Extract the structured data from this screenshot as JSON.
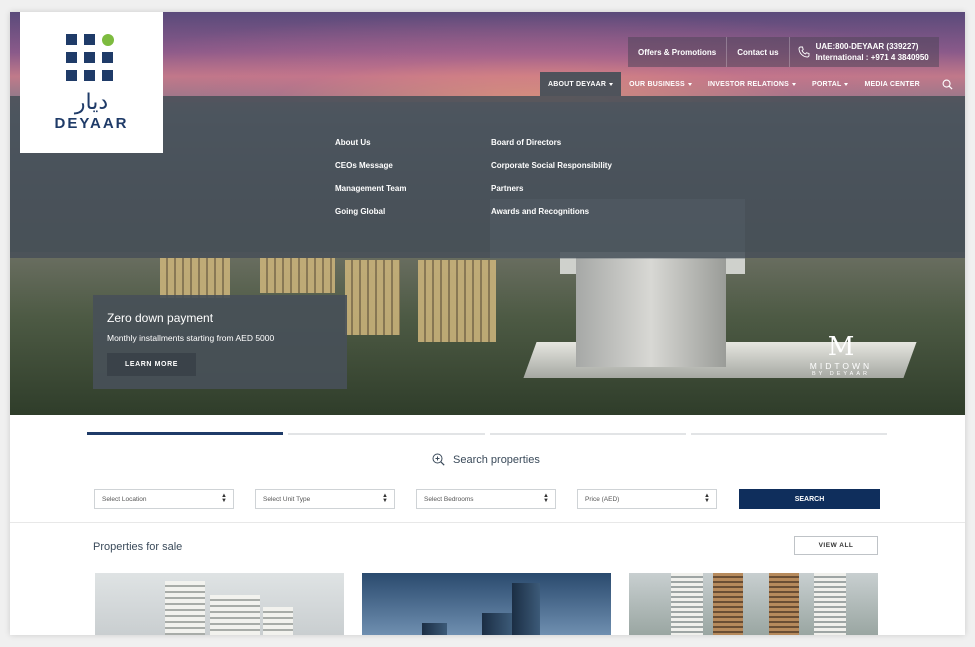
{
  "brand": {
    "arabic": "ديار",
    "name": "DEYAAR"
  },
  "topbar": {
    "offers": "Offers & Promotions",
    "contact": "Contact us",
    "phone_uae": "UAE:800-DEYAAR (339227)",
    "phone_intl": "International : +971 4 3840950"
  },
  "nav": [
    {
      "label": "ABOUT DEYAAR"
    },
    {
      "label": "OUR BUSINESS"
    },
    {
      "label": "INVESTOR RELATIONS"
    },
    {
      "label": "PORTAL"
    },
    {
      "label": "MEDIA CENTER"
    }
  ],
  "mega_menu": {
    "col1": [
      "About Us",
      "CEOs Message",
      "Management Team",
      "Going Global"
    ],
    "col2": [
      "Board of Directors",
      "Corporate Social Responsibility",
      "Partners",
      "Awards and Recognitions"
    ]
  },
  "promo": {
    "title": "Zero down payment",
    "subtitle": "Monthly installments starting from AED 5000",
    "button": "LEARN MORE"
  },
  "hero_logo": {
    "letter": "M",
    "name": "MIDTOWN",
    "by": "BY DEYAAR"
  },
  "search": {
    "title": "Search properties",
    "location": "Select Location",
    "unit_type": "Select Unit Type",
    "bedrooms": "Select Bedrooms",
    "price": "Price (AED)",
    "button": "SEARCH"
  },
  "properties": {
    "title": "Properties for sale",
    "view_all": "VIEW ALL"
  },
  "icons": {
    "phone": "phone-icon",
    "search": "search-icon",
    "zoom": "search-properties-icon"
  },
  "colors": {
    "brand_navy": "#1f3b68",
    "brand_green": "#7dbb3f",
    "search_button": "#0f2e5c"
  }
}
